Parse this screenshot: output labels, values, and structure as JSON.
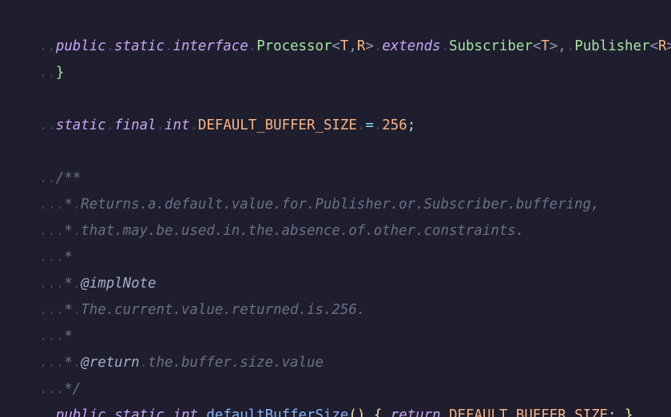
{
  "colors": {
    "background": "#1e1e2e",
    "keyword": "#cba6f7",
    "type": "#a6e3a1",
    "generic_param": "#fab387",
    "bracket": "#f9e2af",
    "constant": "#fab387",
    "function": "#89b4fa",
    "comment": "#6c7086",
    "whitespace_dot": "#45475a"
  },
  "code": {
    "l1": {
      "ws0": "..",
      "kw_public": "public",
      "ws1": ".",
      "kw_static": "static",
      "ws2": ".",
      "kw_interface": "interface",
      "ws3": ".",
      "name": "Processor",
      "lt": "<",
      "t1": "T",
      "comma": ",",
      "t2": "R",
      "gt": ">",
      "ws4": ".",
      "kw_extends": "extends",
      "ws5": ".",
      "sup1": "Subscriber",
      "lt2": "<",
      "t3": "T",
      "gt2": ">",
      "comma2": ",",
      "ws6": ".",
      "sup2": "Publisher",
      "lt3": "<",
      "t4": "R",
      "gt3": ">"
    },
    "l2": {
      "ws0": "..",
      "brace": "}"
    },
    "l3": {
      "ws0": "..",
      "kw_static": "static",
      "ws1": ".",
      "kw_final": "final",
      "ws2": ".",
      "kw_int": "int",
      "ws3": ".",
      "const": "DEFAULT_BUFFER_SIZE",
      "ws4": ".",
      "eq": "=",
      "ws5": ".",
      "num": "256",
      "semi": ";"
    },
    "l4": {
      "ws0": "..",
      "text": "/**"
    },
    "l5": {
      "ws0": "...",
      "star": "*",
      "w1": ".",
      "text": "Returns.a.default.value.for.Publisher.or.Subscriber.buffering,"
    },
    "l6": {
      "ws0": "...",
      "star": "*",
      "w1": ".",
      "text": "that.may.be.used.in.the.absence.of.other.constraints."
    },
    "l7": {
      "ws0": "...",
      "star": "*"
    },
    "l8": {
      "ws0": "...",
      "star": "*",
      "w1": ".",
      "tag": "@implNote"
    },
    "l9": {
      "ws0": "...",
      "star": "*",
      "w1": ".",
      "text": "The.current.value.returned.is.256."
    },
    "l10": {
      "ws0": "...",
      "star": "*"
    },
    "l11": {
      "ws0": "...",
      "star": "*",
      "w1": ".",
      "tag": "@return",
      "w2": ".",
      "text": "the.buffer.size.value"
    },
    "l12": {
      "ws0": "...",
      "text": "*/"
    },
    "l13": {
      "ws0": "..",
      "kw_public": "public",
      "ws1": ".",
      "kw_static": "static",
      "ws2": ".",
      "kw_int": "int",
      "ws3": ".",
      "fn": "defaultBufferSize",
      "parens": "()",
      "ws4": ".",
      "lbrace": "{",
      "ws5": ".",
      "kw_return": "return",
      "ws6": ".",
      "const": "DEFAULT_BUFFER_SIZE",
      "semi": ";",
      "ws7": ".",
      "rbrace": "}"
    }
  }
}
